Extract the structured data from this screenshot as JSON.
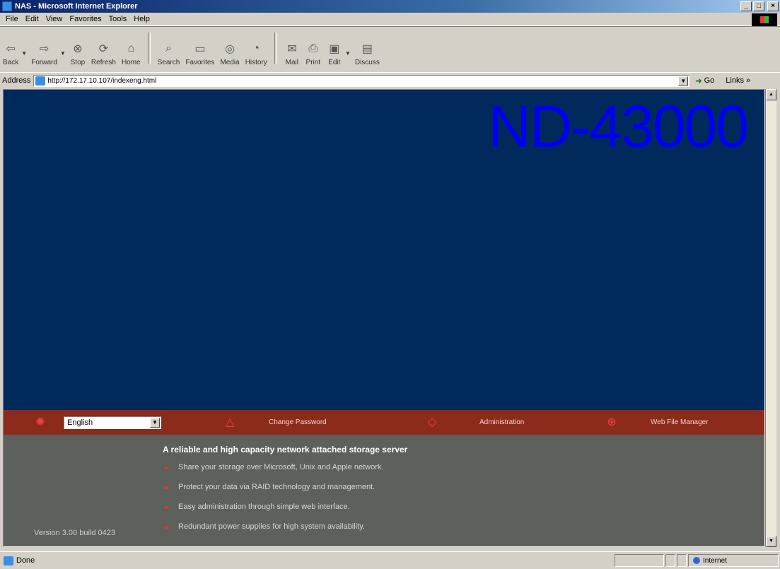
{
  "window": {
    "title": "NAS - Microsoft Internet Explorer",
    "minimize": "_",
    "maximize": "□",
    "close": "×"
  },
  "menu": {
    "items": [
      {
        "u": "F",
        "rest": "ile"
      },
      {
        "u": "E",
        "rest": "dit"
      },
      {
        "u": "V",
        "rest": "iew"
      },
      {
        "u": "F",
        "rest": "a"
      },
      {
        "u": "T",
        "rest": "ools"
      },
      {
        "u": "H",
        "rest": "elp"
      }
    ],
    "labels": [
      "File",
      "Edit",
      "View",
      "Favorites",
      "Tools",
      "Help"
    ]
  },
  "toolbar": {
    "back": "Back",
    "forward": "Forward",
    "stop": "Stop",
    "refresh": "Refresh",
    "home": "Home",
    "search": "Search",
    "favorites": "Favorites",
    "media": "Media",
    "history": "History",
    "mail": "Mail",
    "print": "Print",
    "edit": "Edit",
    "discuss": "Discuss"
  },
  "address": {
    "label": "Address",
    "url": "http://172.17.10.107/indexeng.html",
    "go": "Go",
    "links": "Links »"
  },
  "page": {
    "product_name": "ND-43000",
    "nav": {
      "language_value": "English",
      "change_password": "Change Password",
      "administration": "Administration",
      "web_file_manager": "Web File Manager"
    },
    "tagline": "A reliable and high capacity network attached storage server",
    "bullets": [
      "Share your storage over Microsoft, Unix and Apple network.",
      "Protect your data via RAID technology and management.",
      "Easy administration through simple web interface.",
      "Redundant power supplies for high system availability."
    ],
    "version": "Version 3.00 build 0423"
  },
  "status": {
    "text": "Done",
    "zone": "Internet"
  },
  "colors": {
    "page_background": "#002a5b",
    "product_name": "#0000f0",
    "nav_bar": "#8c2a1c",
    "info_panel": "#5e605c",
    "bullet": "#e33333"
  }
}
